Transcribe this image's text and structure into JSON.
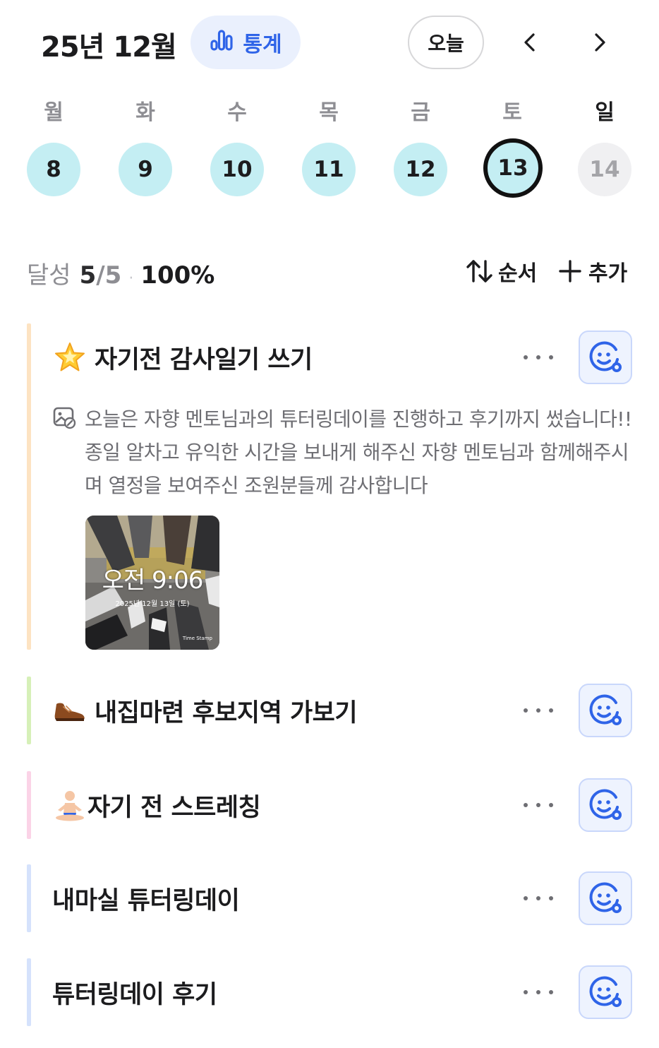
{
  "header": {
    "month_title": "25년 12월",
    "stats_label": "통계",
    "today_label": "오늘"
  },
  "weekdays": [
    "월",
    "화",
    "수",
    "목",
    "금",
    "토",
    "일"
  ],
  "days": [
    {
      "number": "8",
      "state": "done"
    },
    {
      "number": "9",
      "state": "done"
    },
    {
      "number": "10",
      "state": "done"
    },
    {
      "number": "11",
      "state": "done"
    },
    {
      "number": "12",
      "state": "done"
    },
    {
      "number": "13",
      "state": "selected"
    },
    {
      "number": "14",
      "state": "future"
    }
  ],
  "summary": {
    "label": "달성",
    "done": "5",
    "total": "/5",
    "separator": "·",
    "percent": "100%"
  },
  "toolbar": {
    "sort_label": "순서",
    "add_label": "추가"
  },
  "tasks": [
    {
      "icon": "glowing-star-icon",
      "title": "자기전 감사일기 쓰기",
      "bar_color": "#fde3c2",
      "memo": "오늘은 자향 멘토님과의 튜터링데이를 진행하고 후기까지 썼습니다!! 종일 알차고 유익한 시간을 보내게 해주신 자향 멘토님과 함께해주시며 열정을 보여주신 조원분들께 감사합니다",
      "photo": {
        "time": "오전 9:06",
        "date": "2025년 12월 13일 (토)",
        "watermark": "Time Stamp"
      }
    },
    {
      "icon": "shoe-icon",
      "title": "내집마련 후보지역 가보기",
      "bar_color": "#d6f0b8"
    },
    {
      "icon": "meditation-icon",
      "title": "자기 전 스트레칭",
      "bar_color": "#fbd3e7"
    },
    {
      "icon": "",
      "title": "내마실 튜터링데이",
      "bar_color": "#d5e2fc"
    },
    {
      "icon": "",
      "title": "튜터링데이 후기",
      "bar_color": "#d5e2fc"
    }
  ],
  "colors": {
    "accent": "#2f64e8",
    "day_done": "#c4eef3",
    "day_future": "#f0f0f2",
    "selected_ring": "#111111"
  }
}
